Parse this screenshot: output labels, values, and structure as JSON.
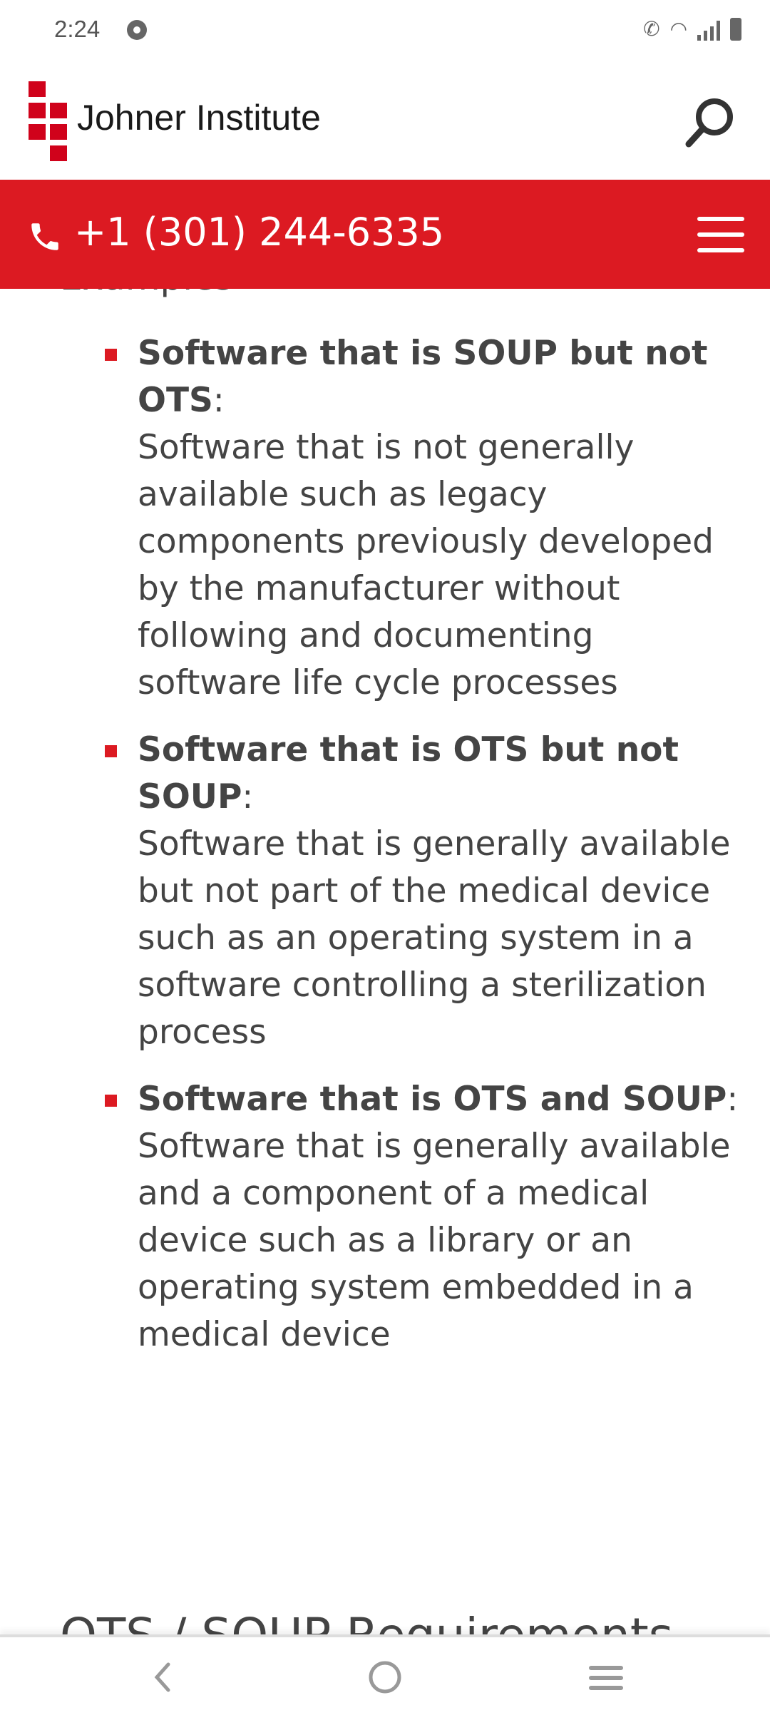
{
  "status_bar": {
    "time": "2:24",
    "icons": [
      "chrome-icon",
      "wifi-call-icon",
      "wifi-icon",
      "signal-icon",
      "battery-icon"
    ]
  },
  "header": {
    "brand": "Johner Institute",
    "search_icon": "search-icon"
  },
  "contact_bar": {
    "phone": "+1 (301) 244-6335",
    "menu_icon": "hamburger-menu-icon",
    "color": "#dc1a22"
  },
  "content": {
    "partial_heading_top": "Examples",
    "items": [
      {
        "title": "Software that is SOUP but not OTS",
        "suffix": ":",
        "text": "Software that is not generally available such as legacy components previously developed by the manufacturer without following and documenting software life cycle processes"
      },
      {
        "title": "Software that is OTS but not SOUP",
        "suffix": ":",
        "text": "Software that is generally available but not part of the medical device such as an operating system in a software controlling a sterilization process"
      },
      {
        "title": "Software that is OTS and SOUP",
        "suffix": ":",
        "text": "Software that is generally available and a component of a medical device such as a library or an operating system embedded in a medical device"
      }
    ],
    "partial_heading_bottom": "OTS / SOUP Requirements"
  },
  "nav_bar": {
    "buttons": [
      "back",
      "home",
      "recents"
    ]
  }
}
